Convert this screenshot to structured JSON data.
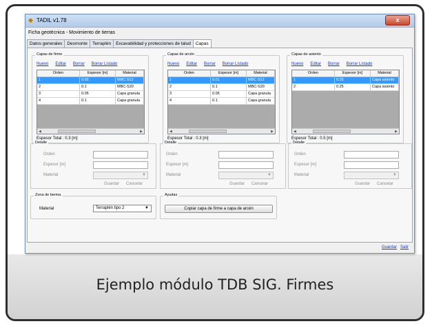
{
  "window": {
    "title": "TADIL v1.78",
    "close_label": "x",
    "subtitle": "Ficha geotécnica - Movimiento de tierras"
  },
  "tabs": [
    {
      "label": "Datos generales",
      "active": false
    },
    {
      "label": "Desmonte",
      "active": false
    },
    {
      "label": "Terraplén",
      "active": false
    },
    {
      "label": "Excavabilidad y protecciones de talud",
      "active": false
    },
    {
      "label": "Capas",
      "active": true
    }
  ],
  "links": {
    "nuevo": "Nuevo",
    "editar": "Editar",
    "borrar": "Borrar",
    "borrar_listado": "Borrar Listado"
  },
  "columns": [
    "Orden",
    "Espesor [m]",
    "Material"
  ],
  "panels": {
    "firme": {
      "title": "Capas de firme",
      "rows": [
        {
          "orden": "1",
          "espesor": "0.05",
          "material": "MBC S12",
          "selected": true
        },
        {
          "orden": "2",
          "espesor": "0.1",
          "material": "MBC-S20",
          "selected": false
        },
        {
          "orden": "3",
          "espesor": "0.05",
          "material": "Capa granula",
          "selected": false
        },
        {
          "orden": "4",
          "espesor": "0.1",
          "material": "Capa granula",
          "selected": false
        }
      ],
      "total": "Espesor Total : 0.3 [m]"
    },
    "arcen": {
      "title": "Capas de arcén",
      "rows": [
        {
          "orden": "1",
          "espesor": "0.01",
          "material": "MBC S12",
          "selected": true
        },
        {
          "orden": "2",
          "espesor": "0.1",
          "material": "MBC-S20",
          "selected": false
        },
        {
          "orden": "3",
          "espesor": "0.05",
          "material": "Capa granula",
          "selected": false
        },
        {
          "orden": "4",
          "espesor": "0.1",
          "material": "Capa granula",
          "selected": false
        }
      ],
      "total": "Espesor Total : 0.3 [m]"
    },
    "asiento": {
      "title": "Capas de asiento",
      "rows": [
        {
          "orden": "1",
          "espesor": "0.25",
          "material": "Capa asiento",
          "selected": true
        },
        {
          "orden": "2",
          "espesor": "0.25",
          "material": "Capa asiento",
          "selected": false
        }
      ],
      "total": "Espesor Total : 0.5 [m]"
    }
  },
  "detalle": {
    "title": "Detalle",
    "orden_label": "Orden",
    "espesor_label": "Espesor [m]",
    "material_label": "Material",
    "guardar": "Guardar",
    "cancelar": "Cancelar"
  },
  "berma": {
    "title": "Zona de berma",
    "material_label": "Material",
    "material_value": "Terraplén tipo 2"
  },
  "ayudas": {
    "title": "Ayudas",
    "copy_button": "Copiar capa de firme a capa de arcén"
  },
  "footer": {
    "guardar": "Guardar",
    "salir": "Salir"
  },
  "caption": "Ejemplo módulo TDB SIG. Firmes",
  "colors": {
    "selected_row": "#3399ff",
    "link": "#0a37d6",
    "close": "#c9462c"
  }
}
